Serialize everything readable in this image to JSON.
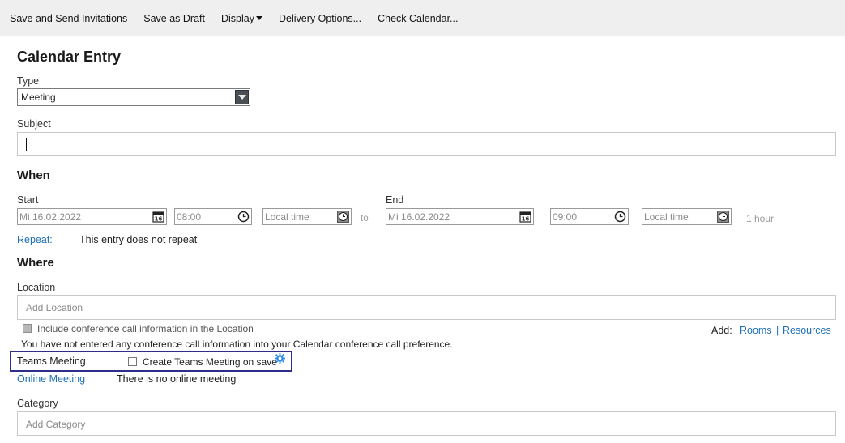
{
  "toolbar": {
    "save_send": "Save and Send Invitations",
    "save_draft": "Save as Draft",
    "display": "Display",
    "delivery": "Delivery Options...",
    "check_calendar": "Check Calendar..."
  },
  "page_title": "Calendar Entry",
  "type": {
    "label": "Type",
    "value": "Meeting"
  },
  "subject": {
    "label": "Subject",
    "value": ""
  },
  "when": {
    "heading": "When",
    "start_label": "Start",
    "start_date": "Mi 16.02.2022",
    "start_time": "08:00",
    "start_tz": "Local time",
    "to": "to",
    "end_label": "End",
    "end_date": "Mi 16.02.2022",
    "end_time": "09:00",
    "end_tz": "Local time",
    "duration": "1 hour",
    "repeat_label": "Repeat:",
    "repeat_value": "This entry does not repeat"
  },
  "where": {
    "heading": "Where",
    "location_label": "Location",
    "location_placeholder": "Add Location",
    "include_conf": "Include conference call information in the Location",
    "conf_note": "You have not entered any conference call information into your Calendar conference call preference.",
    "add_label": "Add:",
    "rooms": "Rooms",
    "separator": "|",
    "resources": "Resources"
  },
  "teams": {
    "label": "Teams Meeting",
    "create": "Create Teams Meeting on save"
  },
  "online": {
    "label": "Online Meeting",
    "value": "There is no online meeting"
  },
  "category": {
    "label": "Category",
    "placeholder": "Add Category"
  },
  "colors": {
    "link": "#1e6fb5",
    "teams_border": "#2d2d8a",
    "toolbar_bg": "#efefef",
    "gear": "#2f8ee8"
  }
}
